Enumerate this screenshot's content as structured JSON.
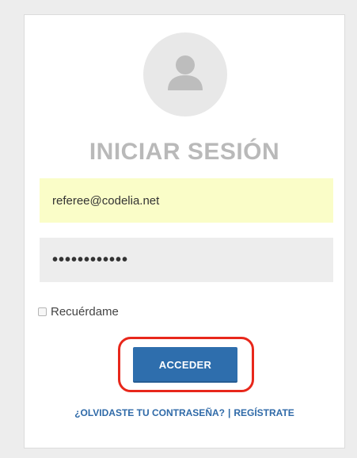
{
  "login": {
    "title": "INICIAR SESIÓN",
    "email_value": "referee@codelia.net",
    "password_value": "••••••••••••",
    "remember_label": "Recuérdame",
    "submit_label": "ACCEDER",
    "forgot_link": "¿OLVIDASTE TU CONTRASEÑA?",
    "separator": "|",
    "register_link": "REGÍSTRATE"
  },
  "icons": {
    "avatar": "user-icon"
  },
  "colors": {
    "button": "#2e6ead",
    "link": "#2f6aa8",
    "title": "#b9b9b9",
    "email_bg": "#fafdc8",
    "highlight": "#e8271b"
  }
}
